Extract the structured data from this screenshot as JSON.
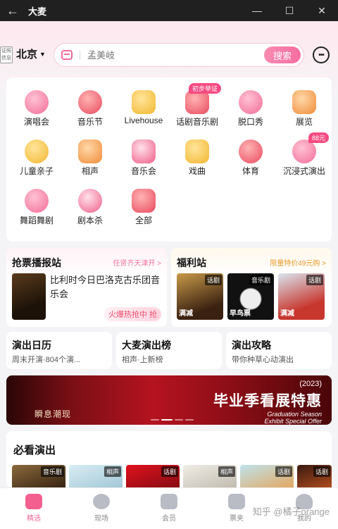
{
  "window": {
    "title": "大麦",
    "back": "←",
    "min": "—",
    "max": "☐",
    "close": "✕"
  },
  "header": {
    "cert": "证照信息",
    "city": "北京",
    "search_placeholder": "孟美岐",
    "search_button": "搜索",
    "message_icon": "chat-bubble-icon"
  },
  "categories": [
    {
      "label": "演唱会",
      "icon": "mic-icon"
    },
    {
      "label": "音乐节",
      "icon": "guitar-icon"
    },
    {
      "label": "Livehouse",
      "icon": "violin-icon"
    },
    {
      "label": "话剧音乐剧",
      "icon": "mask-icon",
      "tag": "初步举证"
    },
    {
      "label": "脱口秀",
      "icon": "lips-icon"
    },
    {
      "label": "展览",
      "icon": "frame-icon"
    },
    {
      "label": "儿童亲子",
      "icon": "duck-icon"
    },
    {
      "label": "相声",
      "icon": "fan-icon"
    },
    {
      "label": "音乐会",
      "icon": "piano-icon"
    },
    {
      "label": "戏曲",
      "icon": "opera-fan-icon"
    },
    {
      "label": "体育",
      "icon": "ball-icon"
    },
    {
      "label": "沉浸式演出",
      "icon": "vr-icon",
      "tag": "88元"
    },
    {
      "label": "舞蹈舞剧",
      "icon": "dancer-icon"
    },
    {
      "label": "剧本杀",
      "icon": "mystery-icon"
    },
    {
      "label": "全部",
      "icon": "grid-icon"
    }
  ],
  "qiangpiao": {
    "title": "抢票播报站",
    "sub": "任贤齐天津开 >",
    "text": "比利时今日巴洛克古乐团音乐会",
    "hot": "火爆热抢中 抢"
  },
  "fuli": {
    "title": "福利站",
    "sub": "限量特价49元购 >",
    "posters": [
      {
        "badge": "话剧",
        "note": "满减"
      },
      {
        "badge": "音乐剧",
        "note": "早鸟票"
      },
      {
        "badge": "话剧",
        "note": "满减"
      }
    ]
  },
  "row3": [
    {
      "title": "演出日历",
      "desc": "周末开演·804个演..."
    },
    {
      "title": "大麦演出榜",
      "desc": "相声·上新榜"
    },
    {
      "title": "演出攻略",
      "desc": "带你种草心动演出"
    }
  ],
  "banner": {
    "left": "瞬息潮现",
    "year": "(2023)",
    "title": "毕业季看展特惠",
    "en1": "Graduation Season",
    "en2": "Exhibit Special Offer"
  },
  "must": {
    "title": "必看演出",
    "badges": [
      "音乐剧",
      "相声",
      "话剧",
      "相声",
      "话剧",
      "话剧"
    ]
  },
  "tabs": [
    {
      "label": "精选",
      "icon": "home-icon",
      "active": true
    },
    {
      "label": "现场",
      "icon": "live-icon"
    },
    {
      "label": "会员",
      "icon": "member-icon"
    },
    {
      "label": "票夹",
      "icon": "ticket-icon"
    },
    {
      "label": "我的",
      "icon": "profile-icon"
    }
  ],
  "watermark": "知乎 @橘子orange"
}
